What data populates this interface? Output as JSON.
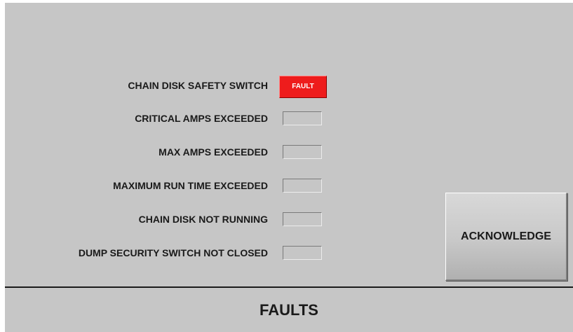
{
  "faults": [
    {
      "label": "CHAIN DISK SAFETY SWITCH",
      "status": "FAULT",
      "active": true
    },
    {
      "label": "CRITICAL AMPS EXCEEDED",
      "status": "",
      "active": false
    },
    {
      "label": "MAX AMPS EXCEEDED",
      "status": "",
      "active": false
    },
    {
      "label": "MAXIMUM RUN TIME EXCEEDED",
      "status": "",
      "active": false
    },
    {
      "label": "CHAIN DISK NOT RUNNING",
      "status": "",
      "active": false
    },
    {
      "label": "DUMP SECURITY SWITCH NOT CLOSED",
      "status": "",
      "active": false
    }
  ],
  "acknowledge_button": {
    "label": "ACKNOWLEDGE"
  },
  "footer": {
    "title": "FAULTS"
  },
  "colors": {
    "background": "#c6c6c6",
    "fault_active": "#ee1c1c",
    "text": "#1a1a1a"
  }
}
